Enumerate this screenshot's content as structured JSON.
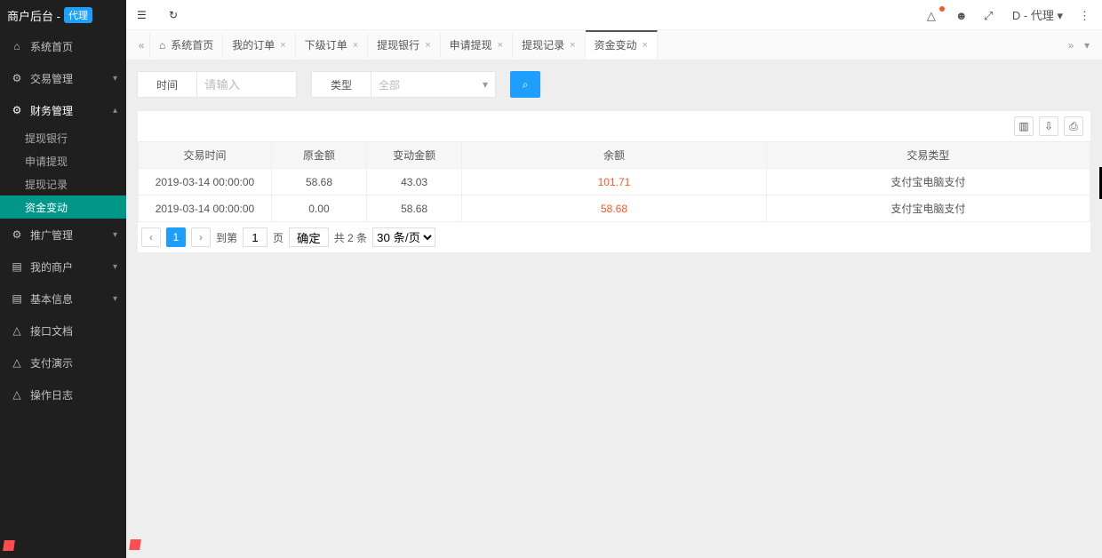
{
  "sidebar": {
    "title": "商户后台 - ",
    "badge": "代理",
    "items": [
      {
        "icon": "⌂",
        "label": "系统首页",
        "caret": false
      },
      {
        "icon": "⚙",
        "label": "交易管理",
        "caret": true
      },
      {
        "icon": "⚙",
        "label": "财务管理",
        "caret": true,
        "open": true,
        "children": [
          {
            "label": "提现银行"
          },
          {
            "label": "申请提现"
          },
          {
            "label": "提现记录"
          },
          {
            "label": "资金变动",
            "active": true
          }
        ]
      },
      {
        "icon": "⚙",
        "label": "推广管理",
        "caret": true
      },
      {
        "icon": "▤",
        "label": "我的商户",
        "caret": true
      },
      {
        "icon": "▤",
        "label": "基本信息",
        "caret": true
      },
      {
        "icon": "△",
        "label": "接口文档",
        "caret": false
      },
      {
        "icon": "△",
        "label": "支付演示",
        "caret": false
      },
      {
        "icon": "△",
        "label": "操作日志",
        "caret": false
      }
    ]
  },
  "header": {
    "user_label": "D - 代理"
  },
  "tabs": {
    "items": [
      {
        "label": "系统首页",
        "home": true,
        "closable": false
      },
      {
        "label": "我的订单",
        "closable": true
      },
      {
        "label": "下级订单",
        "closable": true
      },
      {
        "label": "提现银行",
        "closable": true
      },
      {
        "label": "申请提现",
        "closable": true
      },
      {
        "label": "提现记录",
        "closable": true
      },
      {
        "label": "资金变动",
        "closable": true,
        "active": true
      }
    ]
  },
  "filters": {
    "time_label": "时间",
    "time_placeholder": "请输入",
    "type_label": "类型",
    "type_value": "全部"
  },
  "table": {
    "cols": [
      "交易时间",
      "原金额",
      "变动金额",
      "余额",
      "交易类型"
    ],
    "rows": [
      {
        "time": "2019-03-14 00:00:00",
        "orig": "58.68",
        "change": "43.03",
        "balance": "101.71",
        "type": "支付宝电脑支付"
      },
      {
        "time": "2019-03-14 00:00:00",
        "orig": "0.00",
        "change": "58.68",
        "balance": "58.68",
        "type": "支付宝电脑支付"
      }
    ]
  },
  "pager": {
    "current": "1",
    "to_label": "到第",
    "page_input": "1",
    "page_unit": "页",
    "go": "确定",
    "total": "共 2 条",
    "size": "30 条/页"
  }
}
